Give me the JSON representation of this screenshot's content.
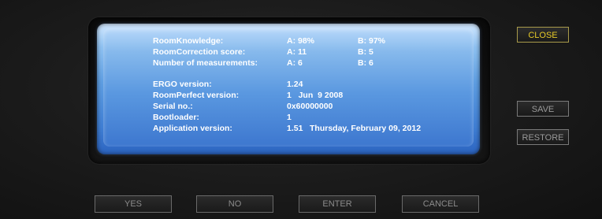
{
  "info": {
    "room_knowledge_label": "RoomKnowledge:",
    "room_knowledge_a": "A: 98%",
    "room_knowledge_b": "B: 97%",
    "room_correction_label": "RoomCorrection score:",
    "room_correction_a": "A: 11",
    "room_correction_b": "B: 5",
    "measurements_label": "Number of measurements:",
    "measurements_a": "A: 6",
    "measurements_b": "B: 6",
    "ergo_label": "ERGO version:",
    "ergo_value": "1.24",
    "roomperfect_label": "RoomPerfect version:",
    "roomperfect_value": "1   Jun  9 2008",
    "serial_label": "Serial no.:",
    "serial_value": "0x60000000",
    "bootloader_label": "Bootloader:",
    "bootloader_value": "1",
    "app_version_label": "Application version:",
    "app_version_value": "1.51",
    "app_version_date": "Thursday, February 09, 2012"
  },
  "side_buttons": {
    "close": "CLOSE",
    "save": "SAVE",
    "restore": "RESTORE"
  },
  "bottom_buttons": {
    "yes": "YES",
    "no": "NO",
    "enter": "ENTER",
    "cancel": "CANCEL"
  },
  "colors": {
    "close_text": "#e6c928",
    "button_text": "#8c8c8c",
    "screen_blue": "#4a8ad8"
  }
}
